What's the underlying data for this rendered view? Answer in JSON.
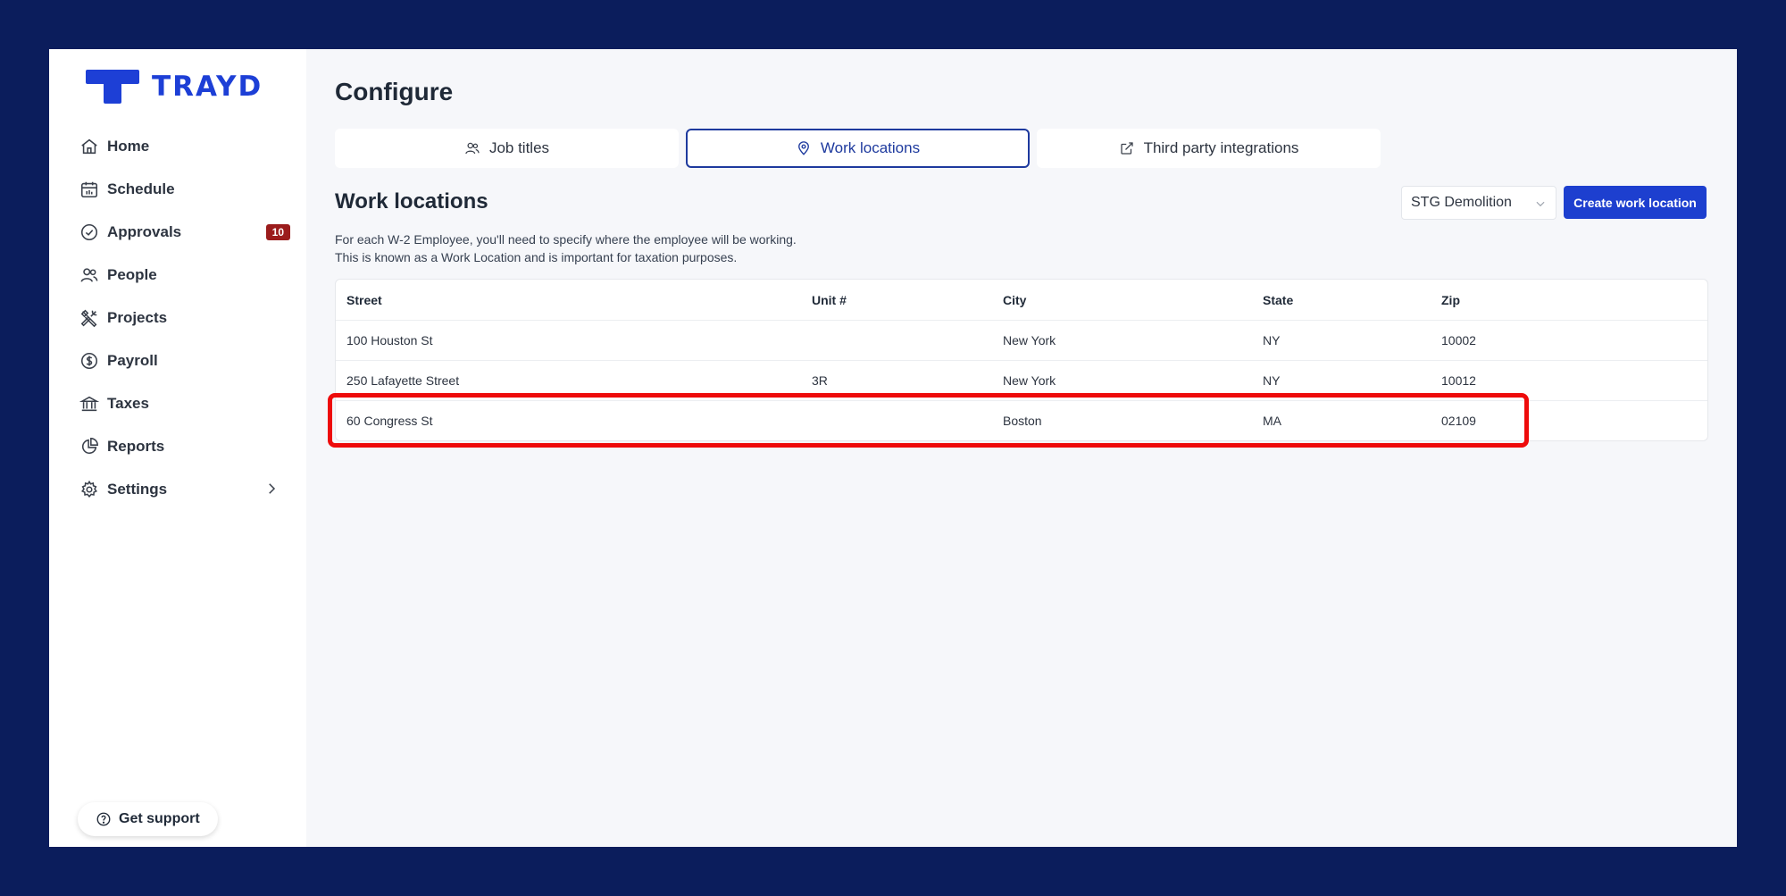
{
  "brand": {
    "name": "TRAYD",
    "color": "#1d3fd6"
  },
  "sidebar": {
    "items": [
      {
        "label": "Home",
        "icon": "home-icon"
      },
      {
        "label": "Schedule",
        "icon": "calendar-icon"
      },
      {
        "label": "Approvals",
        "icon": "check-circle-icon",
        "badge": "10"
      },
      {
        "label": "People",
        "icon": "users-icon"
      },
      {
        "label": "Projects",
        "icon": "tools-icon"
      },
      {
        "label": "Payroll",
        "icon": "dollar-circle-icon"
      },
      {
        "label": "Taxes",
        "icon": "bank-icon"
      },
      {
        "label": "Reports",
        "icon": "pie-chart-icon"
      },
      {
        "label": "Settings",
        "icon": "gear-icon"
      }
    ],
    "support_label": "Get support"
  },
  "main": {
    "title": "Configure",
    "tabs": [
      {
        "label": "Job titles",
        "icon": "users-icon"
      },
      {
        "label": "Work locations",
        "icon": "map-pin-icon",
        "active": true
      },
      {
        "label": "Third party integrations",
        "icon": "external-link-icon"
      }
    ],
    "section_title": "Work locations",
    "description_line1": "For each W-2 Employee, you'll need to specify where the employee will be working.",
    "description_line2": "This is known as a Work Location and is important for taxation purposes.",
    "company_select": "STG Demolition",
    "create_button": "Create work location",
    "table": {
      "headers": [
        "Street",
        "Unit #",
        "City",
        "State",
        "Zip"
      ],
      "rows": [
        [
          "100 Houston St",
          "",
          "New York",
          "NY",
          "10002"
        ],
        [
          "250 Lafayette Street",
          "3R",
          "New York",
          "NY",
          "10012"
        ],
        [
          "60 Congress St",
          "",
          "Boston",
          "MA",
          "02109"
        ]
      ]
    }
  },
  "colors": {
    "frame": "#0b1d5c",
    "accent": "#1d3fcf",
    "badge": "#9b1c1c",
    "highlight": "#ee0b0b"
  }
}
